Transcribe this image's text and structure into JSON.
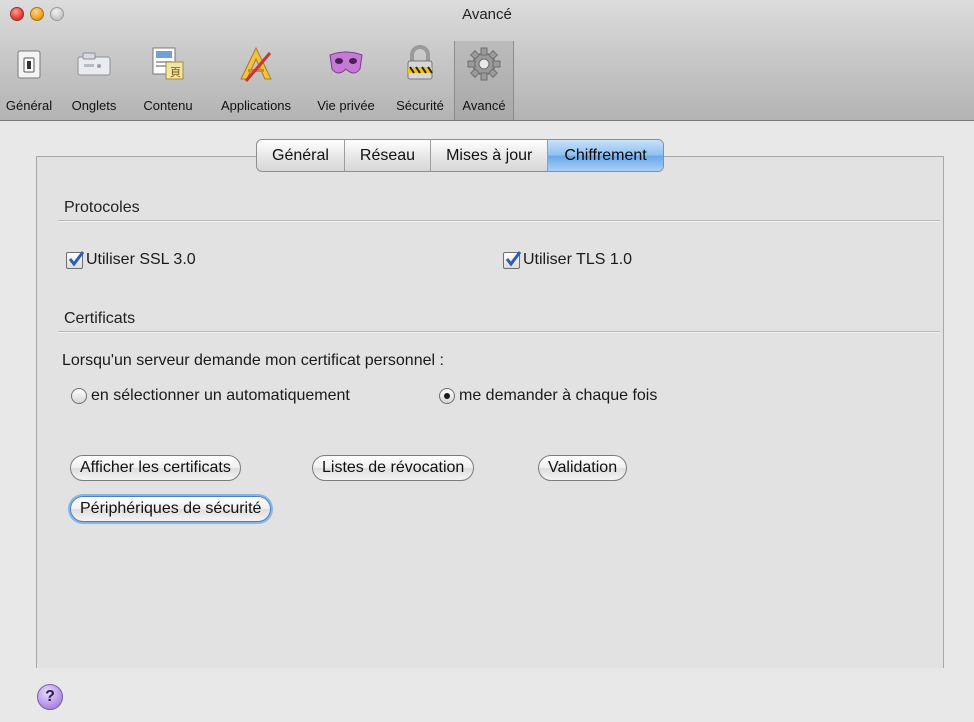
{
  "window": {
    "title": "Avancé"
  },
  "toolbar": {
    "items": [
      {
        "label": "Général",
        "icon": "general-switch-icon"
      },
      {
        "label": "Onglets",
        "icon": "tabs-icon"
      },
      {
        "label": "Contenu",
        "icon": "content-icon"
      },
      {
        "label": "Applications",
        "icon": "applications-icon"
      },
      {
        "label": "Vie privée",
        "icon": "privacy-mask-icon"
      },
      {
        "label": "Sécurité",
        "icon": "security-lock-icon"
      },
      {
        "label": "Avancé",
        "icon": "advanced-gear-icon",
        "selected": true
      }
    ]
  },
  "tabs": {
    "general": "Général",
    "network": "Réseau",
    "updates": "Mises à jour",
    "encryption": "Chiffrement",
    "selected": "Chiffrement"
  },
  "protocols": {
    "title": "Protocoles",
    "ssl_label": "Utiliser SSL 3.0",
    "ssl_checked": true,
    "tls_label": "Utiliser TLS 1.0",
    "tls_checked": true
  },
  "certificates": {
    "title": "Certificats",
    "prompt": "Lorsqu'un serveur demande mon certificat personnel :",
    "option_auto": "en sélectionner un automatiquement",
    "option_ask": "me demander à chaque fois",
    "selected_option": "me demander à chaque fois",
    "buttons": {
      "view_certificates": "Afficher les certificats",
      "revocation_lists": "Listes de révocation",
      "validation": "Validation",
      "security_devices": "Périphériques de sécurité"
    }
  },
  "help": {
    "label": "?"
  },
  "colors": {
    "accent": "#6aa6e8",
    "check": "#2a5fb8"
  }
}
